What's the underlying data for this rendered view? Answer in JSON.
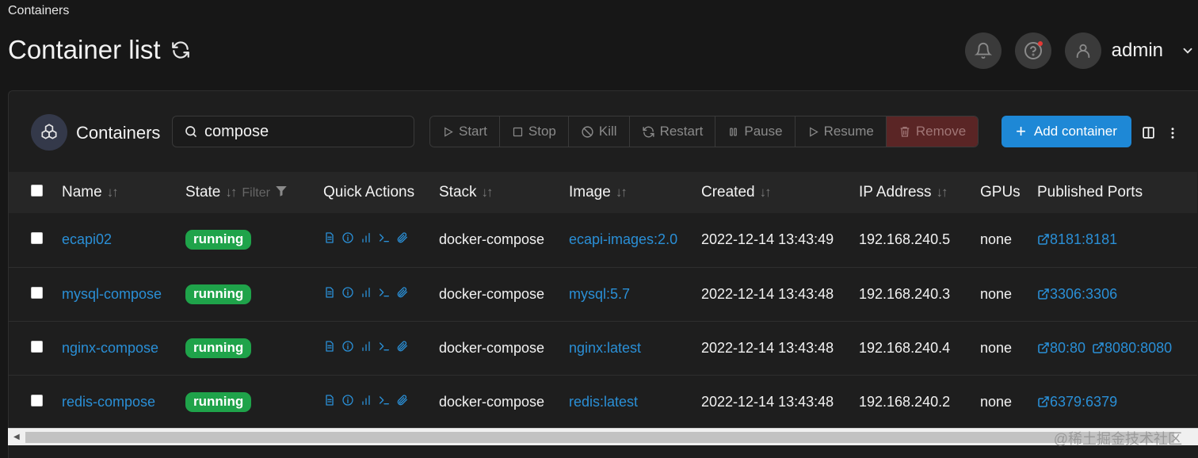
{
  "breadcrumb": "Containers",
  "page_title": "Container list",
  "user": {
    "name": "admin"
  },
  "panel": {
    "title": "Containers",
    "search_value": "compose",
    "actions": [
      "Start",
      "Stop",
      "Kill",
      "Restart",
      "Pause",
      "Resume",
      "Remove"
    ],
    "add_label": "Add container"
  },
  "table": {
    "headers": {
      "name": "Name",
      "state": "State",
      "filter": "Filter",
      "quick_actions": "Quick Actions",
      "stack": "Stack",
      "image": "Image",
      "created": "Created",
      "ip": "IP Address",
      "gpus": "GPUs",
      "ports": "Published Ports"
    },
    "rows": [
      {
        "name": "ecapi02",
        "state": "running",
        "stack": "docker-compose",
        "image": "ecapi-images:2.0",
        "created": "2022-12-14 13:43:49",
        "ip": "192.168.240.5",
        "gpus": "none",
        "ports": [
          "8181:8181"
        ]
      },
      {
        "name": "mysql-compose",
        "state": "running",
        "stack": "docker-compose",
        "image": "mysql:5.7",
        "created": "2022-12-14 13:43:48",
        "ip": "192.168.240.3",
        "gpus": "none",
        "ports": [
          "3306:3306"
        ]
      },
      {
        "name": "nginx-compose",
        "state": "running",
        "stack": "docker-compose",
        "image": "nginx:latest",
        "created": "2022-12-14 13:43:48",
        "ip": "192.168.240.4",
        "gpus": "none",
        "ports": [
          "80:80",
          "8080:8080"
        ]
      },
      {
        "name": "redis-compose",
        "state": "running",
        "stack": "docker-compose",
        "image": "redis:latest",
        "created": "2022-12-14 13:43:48",
        "ip": "192.168.240.2",
        "gpus": "none",
        "ports": [
          "6379:6379"
        ]
      }
    ]
  },
  "watermark": "@稀土掘金技术社区",
  "colors": {
    "accent": "#1e88d6",
    "running": "#1fa34a",
    "link": "#2a8fd6",
    "remove": "#5a2525"
  }
}
